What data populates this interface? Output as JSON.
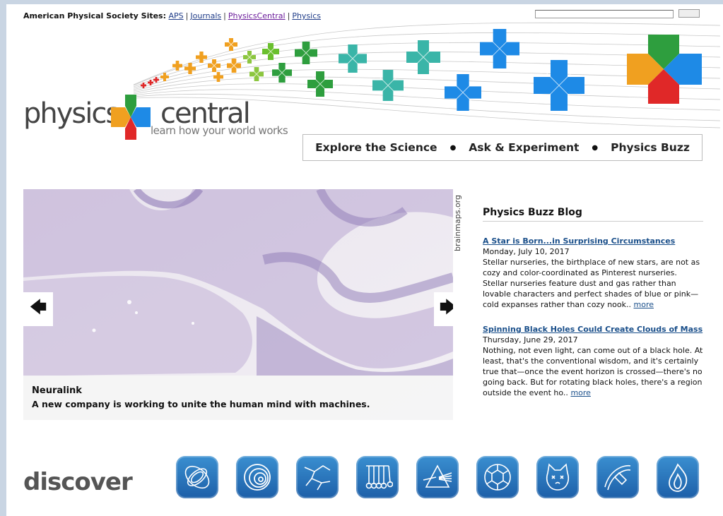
{
  "aps_bar": {
    "label": "American Physical Society Sites:",
    "links": [
      {
        "label": "APS"
      },
      {
        "label": "Journals"
      },
      {
        "label": "PhysicsCentral"
      },
      {
        "label": "Physics"
      }
    ],
    "separator": "|"
  },
  "logo": {
    "word1": "physics",
    "word2": "central",
    "tagline": "learn how your world works"
  },
  "nav": {
    "items": [
      "Explore the Science",
      "Ask & Experiment",
      "Physics Buzz"
    ],
    "dot": "●"
  },
  "slider": {
    "prev_label": "🡄",
    "next_label": "🡆",
    "caption_title": "Neuralink",
    "caption_text": "A new company is working to unite the human mind with machines.",
    "credit": "brainmaps.org"
  },
  "blog": {
    "title": "Physics Buzz Blog",
    "posts": [
      {
        "title": "A Star is Born...in Surprising Circumstances",
        "date": "Monday, July 10, 2017",
        "excerpt": "Stellar nurseries, the birthplace of new stars, are not as cozy and color-coordinated as Pinterest nurseries. Stellar nurseries feature dust and gas rather than lovable characters and perfect shades of blue or pink—cold expanses rather than cozy nook..",
        "more": "more"
      },
      {
        "title": "Spinning Black Holes Could Create Clouds of Mass",
        "date": "Thursday, June 29, 2017",
        "excerpt": "Nothing, not even light, can come out of a black hole. At least, that's the conventional wisdom, and it's certainly true that—once the event horizon is crossed—there's no going back. But for rotating black holes, there's a region outside the event ho..",
        "more": "more"
      }
    ]
  },
  "discover": {
    "label": "discover",
    "icons": [
      "orbit-icon",
      "spiral-icon",
      "lightning-icon",
      "pendulum-icon",
      "prism-icon",
      "molecule-icon",
      "cat-icon",
      "satellite-icon",
      "flame-icon"
    ]
  },
  "colors": {
    "link": "#1f3c88",
    "link_visited": "#6a1b9a",
    "blog_link": "#1a4f8a",
    "icon_blue": "#2a78c0",
    "brand_green": "#2e9e3e",
    "brand_orange": "#f0a020",
    "brand_red": "#e02828",
    "brand_blue": "#1e8ae6"
  }
}
